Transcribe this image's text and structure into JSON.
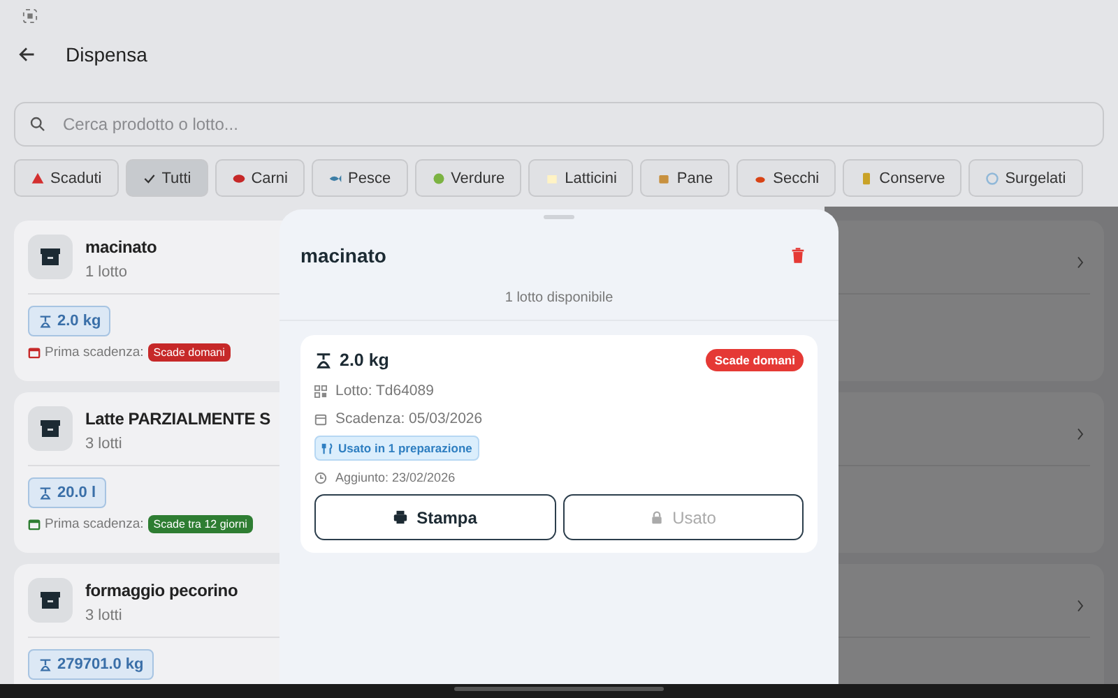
{
  "header": {
    "title": "Dispensa"
  },
  "search": {
    "placeholder": "Cerca prodotto o lotto..."
  },
  "filters": [
    {
      "label": "Scaduti",
      "selected": false
    },
    {
      "label": "Tutti",
      "selected": true
    },
    {
      "label": "Carni",
      "selected": false
    },
    {
      "label": "Pesce",
      "selected": false
    },
    {
      "label": "Verdure",
      "selected": false
    },
    {
      "label": "Latticini",
      "selected": false
    },
    {
      "label": "Pane",
      "selected": false
    },
    {
      "label": "Secchi",
      "selected": false
    },
    {
      "label": "Conserve",
      "selected": false
    },
    {
      "label": "Surgelati",
      "selected": false
    }
  ],
  "products": [
    {
      "name": "macinato",
      "count": "1 lotto",
      "quantity": "2.0 kg",
      "expiry_label": "Prima scadenza:",
      "expiry_badge": "Scade domani",
      "color": "#c62828"
    },
    {
      "name": "Latte PARZIALMENTE S",
      "count": "3 lotti",
      "quantity": "20.0 l",
      "expiry_label": "Prima scadenza:",
      "expiry_badge": "Scade tra 12 giorni",
      "color": "#2e7d32"
    },
    {
      "name": "formaggio pecorino",
      "count": "3 lotti",
      "quantity": "279701.0 kg"
    }
  ],
  "sheet": {
    "title": "macinato",
    "subtitle": "1 lotto disponibile",
    "lots": [
      {
        "quantity": "2.0 kg",
        "badge": "Scade domani",
        "color": "#e53935",
        "lot": "Lotto: Td64089",
        "expiry": "Scadenza: 05/03/2026",
        "usage": "Usato in 1 preparazione",
        "added": "Aggiunto: 23/02/2026",
        "print_button": "Stampa",
        "used_button": "Usato",
        "used_disabled": true
      }
    ]
  }
}
